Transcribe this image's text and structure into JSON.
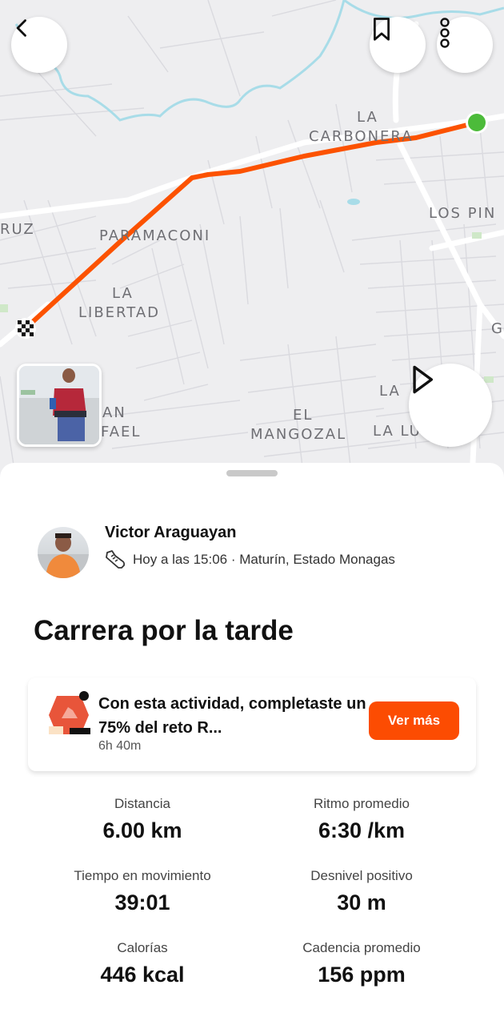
{
  "map": {
    "labels": [
      "LA",
      "CARBONERA",
      "LOS PIN",
      "RUZ",
      "PARAMACONI",
      "LA",
      "LIBERTAD",
      "G",
      "LA",
      "AN",
      "FAEL",
      "EL",
      "MANGOZAL",
      "LA LU"
    ],
    "route_color": "#fc5200",
    "start_color": "#4cbb3a"
  },
  "header": {
    "back_icon": "chevron-left-icon",
    "bookmark_icon": "bookmark-icon",
    "more_icon": "more-vertical-icon"
  },
  "play_icon": "play-icon",
  "athlete": {
    "name": "Victor Araguayan",
    "meta": "Hoy a las 15:06 · Maturín, Estado Monagas",
    "activity_icon": "run-shoe-icon"
  },
  "activity": {
    "title": "Carrera por la tarde"
  },
  "challenge": {
    "text": "Con esta actividad, completaste un 75% del reto R...",
    "sub": "6h 40m",
    "button": "Ver más",
    "accent": "#fc4c02"
  },
  "stats": [
    {
      "label": "Distancia",
      "value": "6.00 km"
    },
    {
      "label": "Ritmo promedio",
      "value": "6:30 /km"
    },
    {
      "label": "Tiempo en movimiento",
      "value": "39:01"
    },
    {
      "label": "Desnivel positivo",
      "value": "30 m"
    },
    {
      "label": "Calorías",
      "value": "446 kcal"
    },
    {
      "label": "Cadencia promedio",
      "value": "156 ppm"
    }
  ]
}
